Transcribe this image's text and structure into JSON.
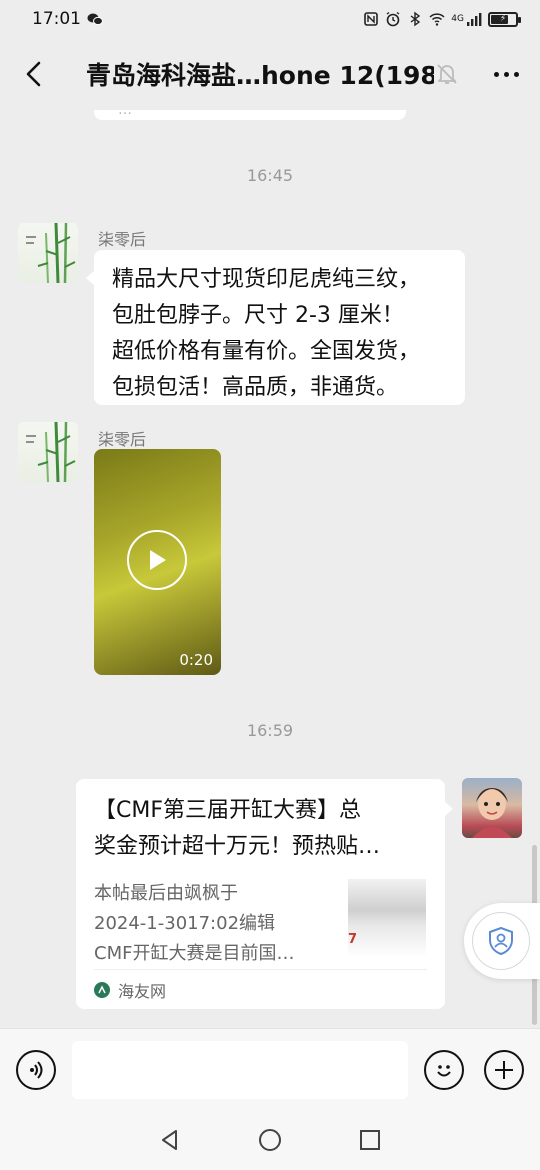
{
  "status_bar": {
    "time": "17:01",
    "network": "4G"
  },
  "header": {
    "title": "青岛海科海盐…hone 12(198)"
  },
  "chat": {
    "partial_bubble_text": "…",
    "messages": [
      {
        "type": "time",
        "text": "16:45"
      },
      {
        "type": "text",
        "sender": "柒零后",
        "lines": [
          "精品大尺寸现货印尼虎纯三纹，",
          "包肚包脖子。尺寸 2-3 厘米！",
          "超低价格有量有价。全国发货，",
          "包损包活！高品质，非通货。"
        ]
      },
      {
        "type": "video",
        "sender": "柒零后",
        "duration": "0:20"
      },
      {
        "type": "time",
        "text": "16:59"
      },
      {
        "type": "link",
        "title_lines": [
          "【CMF第三届开缸大赛】总",
          "奖金预计超十万元！预热贴…"
        ],
        "desc_lines": [
          "本帖最后由飒枫于",
          "2024-1-3017:02编辑",
          "CMF开缸大赛是目前国…"
        ],
        "source": "海友网",
        "thumb_text": "7"
      }
    ]
  },
  "input": {
    "placeholder": ""
  }
}
